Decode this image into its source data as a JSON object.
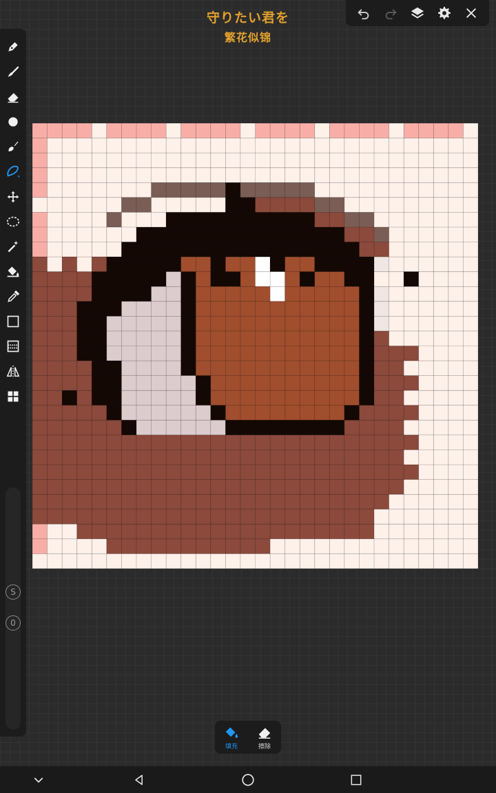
{
  "title": {
    "line1": "守りたい君を",
    "line2": "繁花似锦"
  },
  "top_toolbar": {
    "icons": [
      "undo-icon",
      "redo-icon",
      "layers-icon",
      "gear-icon",
      "close-icon"
    ]
  },
  "left_toolbar": {
    "tools": [
      "pen-icon",
      "brush-icon",
      "eraser-icon",
      "dot-icon",
      "paint-brush-icon",
      "lasso-pen-icon",
      "move-icon",
      "lasso-select-icon",
      "magic-wand-icon",
      "paint-bucket-icon",
      "eyedropper-icon",
      "rectangle-icon",
      "gradient-icon",
      "symmetry-icon",
      "grid-apps-icon"
    ],
    "active_tool": "lasso-pen-icon",
    "size_button": "S",
    "opacity_button": "0"
  },
  "bottom_panel": {
    "fill_label": "填充",
    "erase_label": "擦除",
    "active": "fill"
  },
  "colors": {
    "accent": "#2196f3",
    "title": "#e2a12c",
    "palette": {
      "W": "#fdf1ea",
      "P": "#f8aea7",
      "B": "#8b4a3c",
      "K": "#140804",
      "O": "#a04e2e",
      "G": "#dcccce",
      "T": "#7a5e56",
      "H": "#ffffff",
      "L": "#f0e6e3"
    }
  },
  "canvas": {
    "columns": 30,
    "rows": 30,
    "pixels": [
      "PPPPWPPPPWPPPPWPPPPWPPPPWPPPPW",
      "PWWWWWWWWWWWWWWWWWWWWWWWWWWWWW",
      "PWWWWWWWWWWWWWWWWWWWWWWWWWWWWW",
      "PWWWWWWWWWWWWWWWWWWWWWWWWWWWWW",
      "PWWWWWWWTTTTTKTTTTTWWWWWWWWWWW",
      "WWWWWWTTWWWWWKKBBBBTTWWWWWWWWW",
      "PWWWWTWWWKKKKKKKKKKBBTTWWWWWWW",
      "PWWWWWWKKKKKKKKKKKKKKBBTWWWWWW",
      "PWWWWWKKKKKKKKKKKKKKKKBBWWWWWW",
      "BWBWBKKKKKOOKOOHKOOKKKKLWWWWWW",
      "BBBBKKKKKGKOKKOHHOKOOKKWWKWWWW",
      "BBBBKKKKGGKOOOOOHOOOOOKLWWWWWW",
      "BBBKKKGGGGKOOOOOOOOOOOKLWWWWWW",
      "BBBKKGGGGGKOOOOOOOOOOOKLWWWWWW",
      "BBBKKGGGGGKOOOOOOOOOOOKBWWWWWW",
      "BBBKKGGGGGKOOOOOOOOOOOKBBBWWWW",
      "BBBBKKGGGGKOOOOOOOOOOOKBBWWWWW",
      "BBBBKKGGGGGKOOOOOOOOOOKBBBWWWW",
      "BBKBKKGGGGGKOOOOOOOOOOKBBWWWWW",
      "BBBBBKGGGGGGKOOOOOOOOKBBBBWWWW",
      "BBBBBBKGGGGGGKKKKKKKKBBBBWWWWW",
      "BBBBBBBBBBBBBBBBBBBBBBBBBBWWWW",
      "BBBBBBBBBBBBBBBBBBBBBBBBBWWWWW",
      "BBBBBBBBBBBBBBBBBBBBBBBBBBWWWW",
      "BBBBBBBBBBBBBBBBBBBBBBBBBWWWWW",
      "BBBBBBBBBBBBBBBBBBBBBBBBWWWWWW",
      "BBBBBBBBBBBBBBBBBBBBBBBWWWWWWW",
      "PWWBBBBBBBBBBBBBBBBBBBBWWWWWWW",
      "PWWWWBBBBBBBBBBBWWWWWWWWWWWWWW",
      "WWWWWWWWWWWWWWWWWWWWWWWWWWWWWW"
    ]
  }
}
